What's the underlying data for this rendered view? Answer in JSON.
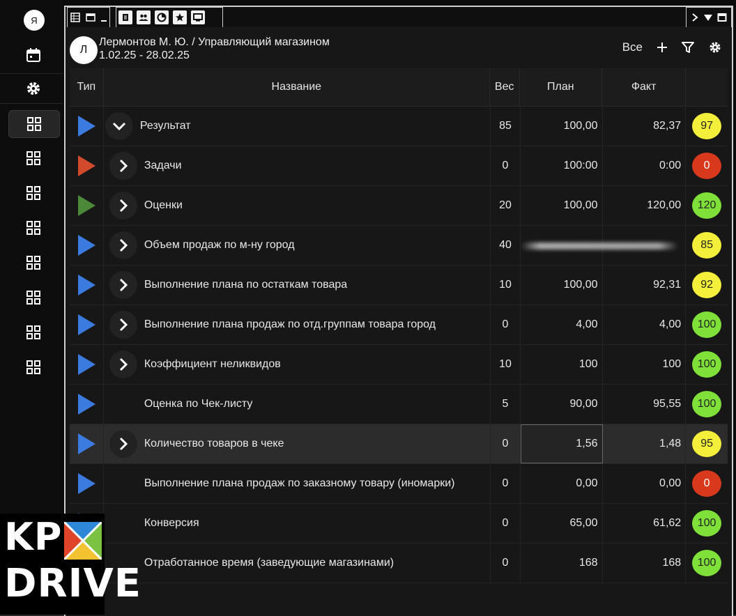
{
  "sidebar": {
    "me_initial": "Я",
    "items": [
      {
        "icon": "calendar-icon"
      },
      {
        "icon": "gear-icon"
      },
      {
        "icon": "grid-icon",
        "active": true
      },
      {
        "icon": "grid-icon"
      },
      {
        "icon": "grid-icon"
      },
      {
        "icon": "grid-icon"
      },
      {
        "icon": "grid-icon"
      },
      {
        "icon": "grid-icon"
      },
      {
        "icon": "grid-icon"
      },
      {
        "icon": "grid-icon"
      }
    ]
  },
  "tabbar": {
    "left_icons": [
      "table-icon",
      "window-icon",
      "minimize-icon"
    ],
    "tab_icons": [
      "document-icon",
      "people-icon",
      "chart-circle-icon",
      "star-icon",
      "monitor-icon"
    ],
    "right_icons": [
      "chevron-right-icon",
      "triangle-down-icon",
      "maximize-icon"
    ]
  },
  "header": {
    "avatar_initial": "Л",
    "title": "Лермонтов М. Ю. / Управляющий магазином",
    "period": "1.02.25 - 28.02.25",
    "filter_label": "Все"
  },
  "table": {
    "columns": {
      "type": "Тип",
      "name": "Название",
      "weight": "Вес",
      "plan": "План",
      "fact": "Факт"
    },
    "rows": [
      {
        "type_color": "#3b7be0",
        "expand": "down",
        "root": true,
        "name": "Результат",
        "weight": "85",
        "plan": "100,00",
        "fact": "82,37",
        "score": "97",
        "score_color": "#f4ef3a"
      },
      {
        "type_color": "#d24a2c",
        "expand": "right",
        "name": "Задачи",
        "weight": "0",
        "plan": "100:00",
        "fact": "0:00",
        "score": "0",
        "score_color": "#d8391c"
      },
      {
        "type_color": "#4c8a3a",
        "expand": "right",
        "name": "Оценки",
        "weight": "20",
        "plan": "100,00",
        "fact": "120,00",
        "score": "120",
        "score_color": "#7fe03a"
      },
      {
        "type_color": "#3b7be0",
        "expand": "right",
        "name": "Объем продаж по м-ну город",
        "weight": "40",
        "plan": "",
        "fact": "",
        "blurred": true,
        "score": "85",
        "score_color": "#f4ef3a"
      },
      {
        "type_color": "#3b7be0",
        "expand": "right",
        "name": "Выполнение плана по остаткам товара",
        "weight": "10",
        "plan": "100,00",
        "fact": "92,31",
        "score": "92",
        "score_color": "#f4ef3a"
      },
      {
        "type_color": "#3b7be0",
        "expand": "right",
        "name": "Выполнение плана продаж по отд.группам товара город",
        "weight": "0",
        "plan": "4,00",
        "fact": "4,00",
        "score": "100",
        "score_color": "#7fe03a"
      },
      {
        "type_color": "#3b7be0",
        "expand": "right",
        "name": "Коэффициент неликвидов",
        "weight": "10",
        "plan": "100",
        "fact": "100",
        "score": "100",
        "score_color": "#7fe03a"
      },
      {
        "type_color": "#3b7be0",
        "expand": "none",
        "name": "Оценка по Чек-листу",
        "weight": "5",
        "plan": "90,00",
        "fact": "95,55",
        "score": "100",
        "score_color": "#7fe03a"
      },
      {
        "type_color": "#3b7be0",
        "expand": "right",
        "name": "Количество товаров в чеке",
        "weight": "0",
        "plan": "1,56",
        "fact": "1,48",
        "score": "95",
        "score_color": "#f4ef3a",
        "highlight": true
      },
      {
        "type_color": "#3b7be0",
        "expand": "none",
        "name": "Выполнение плана продаж по заказному товару (иномарки)",
        "weight": "0",
        "plan": "0,00",
        "fact": "0,00",
        "score": "0",
        "score_color": "#d8391c"
      },
      {
        "type_color": "#3b7be0",
        "expand": "none",
        "name": "Конверсия",
        "weight": "0",
        "plan": "65,00",
        "fact": "61,62",
        "score": "100",
        "score_color": "#7fe03a"
      },
      {
        "type_color": "#3b7be0",
        "expand": "none",
        "name": "Отработанное время (заведующие магазинами)",
        "weight": "0",
        "plan": "168",
        "fact": "168",
        "score": "100",
        "score_color": "#7fe03a"
      }
    ]
  },
  "logo": {
    "line1": "KPI",
    "line2": "DRIVE"
  }
}
